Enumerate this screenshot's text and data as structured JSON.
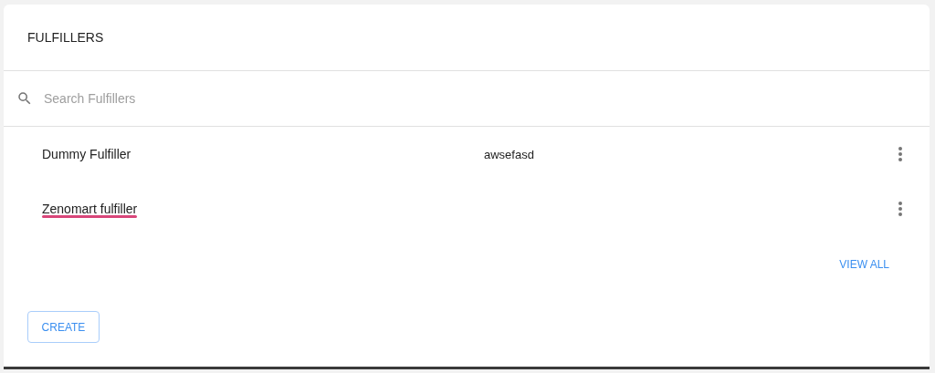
{
  "title": "FULFILLERS",
  "search": {
    "placeholder": "Search Fulfillers"
  },
  "rows": [
    {
      "name": "Dummy Fulfiller",
      "detail": "awsefasd",
      "redacted": false
    },
    {
      "name": "Zenomart fulfiller",
      "redacted": true
    }
  ],
  "view_all": "VIEW ALL",
  "create": "CREATE"
}
